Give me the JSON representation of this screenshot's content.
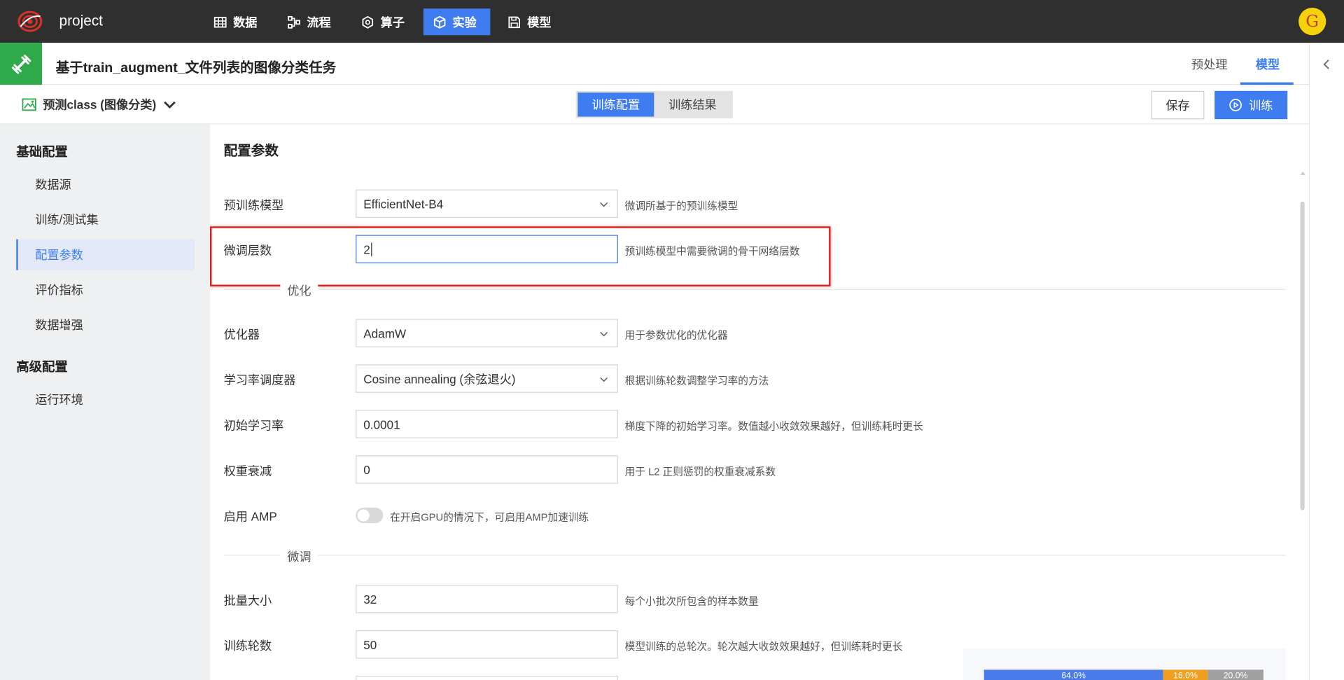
{
  "app": {
    "project_name": "project",
    "avatar_letter": "G"
  },
  "nav": [
    {
      "label": "数据",
      "icon": "table-icon",
      "active": false
    },
    {
      "label": "流程",
      "icon": "flow-icon",
      "active": false
    },
    {
      "label": "算子",
      "icon": "operator-icon",
      "active": false
    },
    {
      "label": "实验",
      "icon": "cube-icon",
      "active": true
    },
    {
      "label": "模型",
      "icon": "save-icon",
      "active": false
    }
  ],
  "header": {
    "title": "基于train_augment_文件列表的图像分类任务",
    "tabs": [
      {
        "label": "预处理",
        "active": false
      },
      {
        "label": "模型",
        "active": true
      }
    ]
  },
  "toolbar": {
    "model_select": "预测class (图像分类)",
    "segments": [
      {
        "label": "训练配置",
        "active": true
      },
      {
        "label": "训练结果",
        "active": false
      }
    ],
    "save_label": "保存",
    "train_label": "训练"
  },
  "sidebar": {
    "groups": [
      {
        "title": "基础配置",
        "items": [
          {
            "label": "数据源",
            "active": false
          },
          {
            "label": "训练/测试集",
            "active": false
          },
          {
            "label": "配置参数",
            "active": true
          },
          {
            "label": "评价指标",
            "active": false
          },
          {
            "label": "数据增强",
            "active": false
          }
        ]
      },
      {
        "title": "高级配置",
        "items": [
          {
            "label": "运行环境",
            "active": false
          }
        ]
      }
    ]
  },
  "main": {
    "section_title": "配置参数",
    "rows": {
      "pretrained": {
        "label": "预训练模型",
        "value": "EfficientNet-B4",
        "hint": "微调所基于的预训练模型"
      },
      "finetune_layers": {
        "label": "微调层数",
        "value": "2",
        "hint": "预训练模型中需要微调的骨干网络层数"
      },
      "optimizer": {
        "label": "优化器",
        "value": "AdamW",
        "hint": "用于参数优化的优化器"
      },
      "scheduler": {
        "label": "学习率调度器",
        "value": "Cosine annealing (余弦退火)",
        "hint": "根据训练轮数调整学习率的方法"
      },
      "lr": {
        "label": "初始学习率",
        "value": "0.0001",
        "hint": "梯度下降的初始学习率。数值越小收敛效果越好，但训练耗时更长"
      },
      "weight_decay": {
        "label": "权重衰减",
        "value": "0",
        "hint": "用于 L2 正则惩罚的权重衰减系数"
      },
      "amp": {
        "label": "启用 AMP",
        "enabled": false,
        "hint": "在开启GPU的情况下，可启用AMP加速训练"
      },
      "batch_size": {
        "label": "批量大小",
        "value": "32",
        "hint": "每个小批次所包含的样本数量"
      },
      "epochs": {
        "label": "训练轮数",
        "value": "50",
        "hint": "模型训练的总轮次。轮次越大收敛效果越好，但训练耗时更长"
      }
    },
    "dividers": {
      "optimize": "优化",
      "finetune": "微调"
    }
  },
  "split_preview": {
    "segments": [
      {
        "label": "64.0%",
        "fraction": 0.64,
        "color": "#4a7be8"
      },
      {
        "label": "16.0%",
        "fraction": 0.16,
        "color": "#f0a020"
      },
      {
        "label": "20.0%",
        "fraction": 0.2,
        "color": "#a0a0a0"
      }
    ]
  },
  "colors": {
    "accent": "#3e7cf0",
    "topbar": "#2f2f2f",
    "brand_green": "#2eaa4a",
    "highlight": "#e0201c"
  }
}
